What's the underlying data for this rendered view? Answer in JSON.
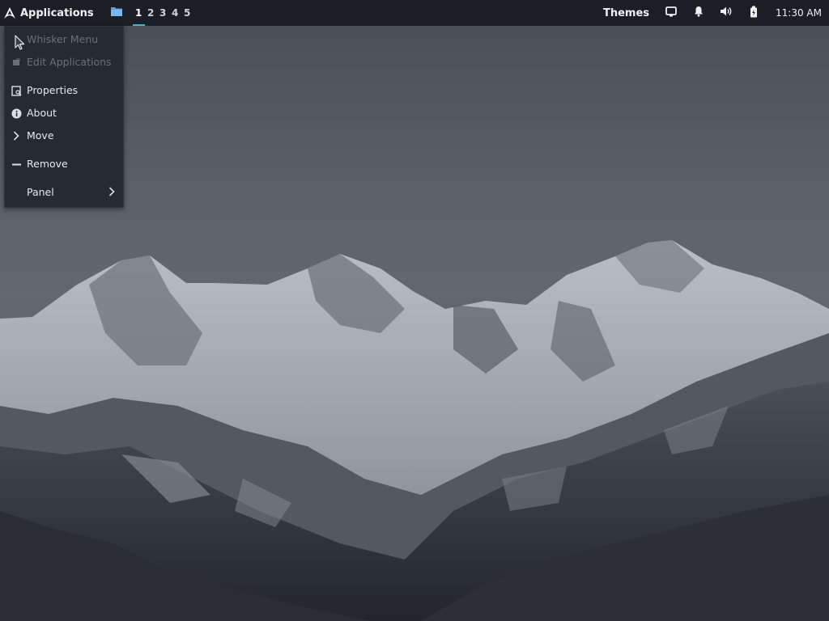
{
  "panel": {
    "apps_label": "Applications",
    "workspaces": [
      "1",
      "2",
      "3",
      "4",
      "5"
    ],
    "active_workspace": "1",
    "themes_label": "Themes",
    "clock": "11:30 AM",
    "icons": {
      "logo": "arch-logo-icon",
      "files": "folder-icon",
      "display": "display-icon",
      "notifications": "bell-icon",
      "volume": "volume-icon",
      "battery": "battery-icon"
    },
    "accent": "#3fb6c9"
  },
  "menu": {
    "items": [
      {
        "label": "Whisker Menu",
        "icon": "whisker-menu-icon",
        "enabled": false
      },
      {
        "label": "Edit Applications",
        "icon": "edit-applications-icon",
        "enabled": false
      },
      {
        "label": "Properties",
        "icon": "properties-icon",
        "enabled": true
      },
      {
        "label": "About",
        "icon": "info-icon",
        "enabled": true
      },
      {
        "label": "Move",
        "icon": "chevron-right-icon",
        "enabled": true
      },
      {
        "label": "Remove",
        "icon": "minus-icon",
        "enabled": true
      },
      {
        "label": "Panel",
        "icon": "",
        "enabled": true,
        "submenu": true
      }
    ]
  }
}
